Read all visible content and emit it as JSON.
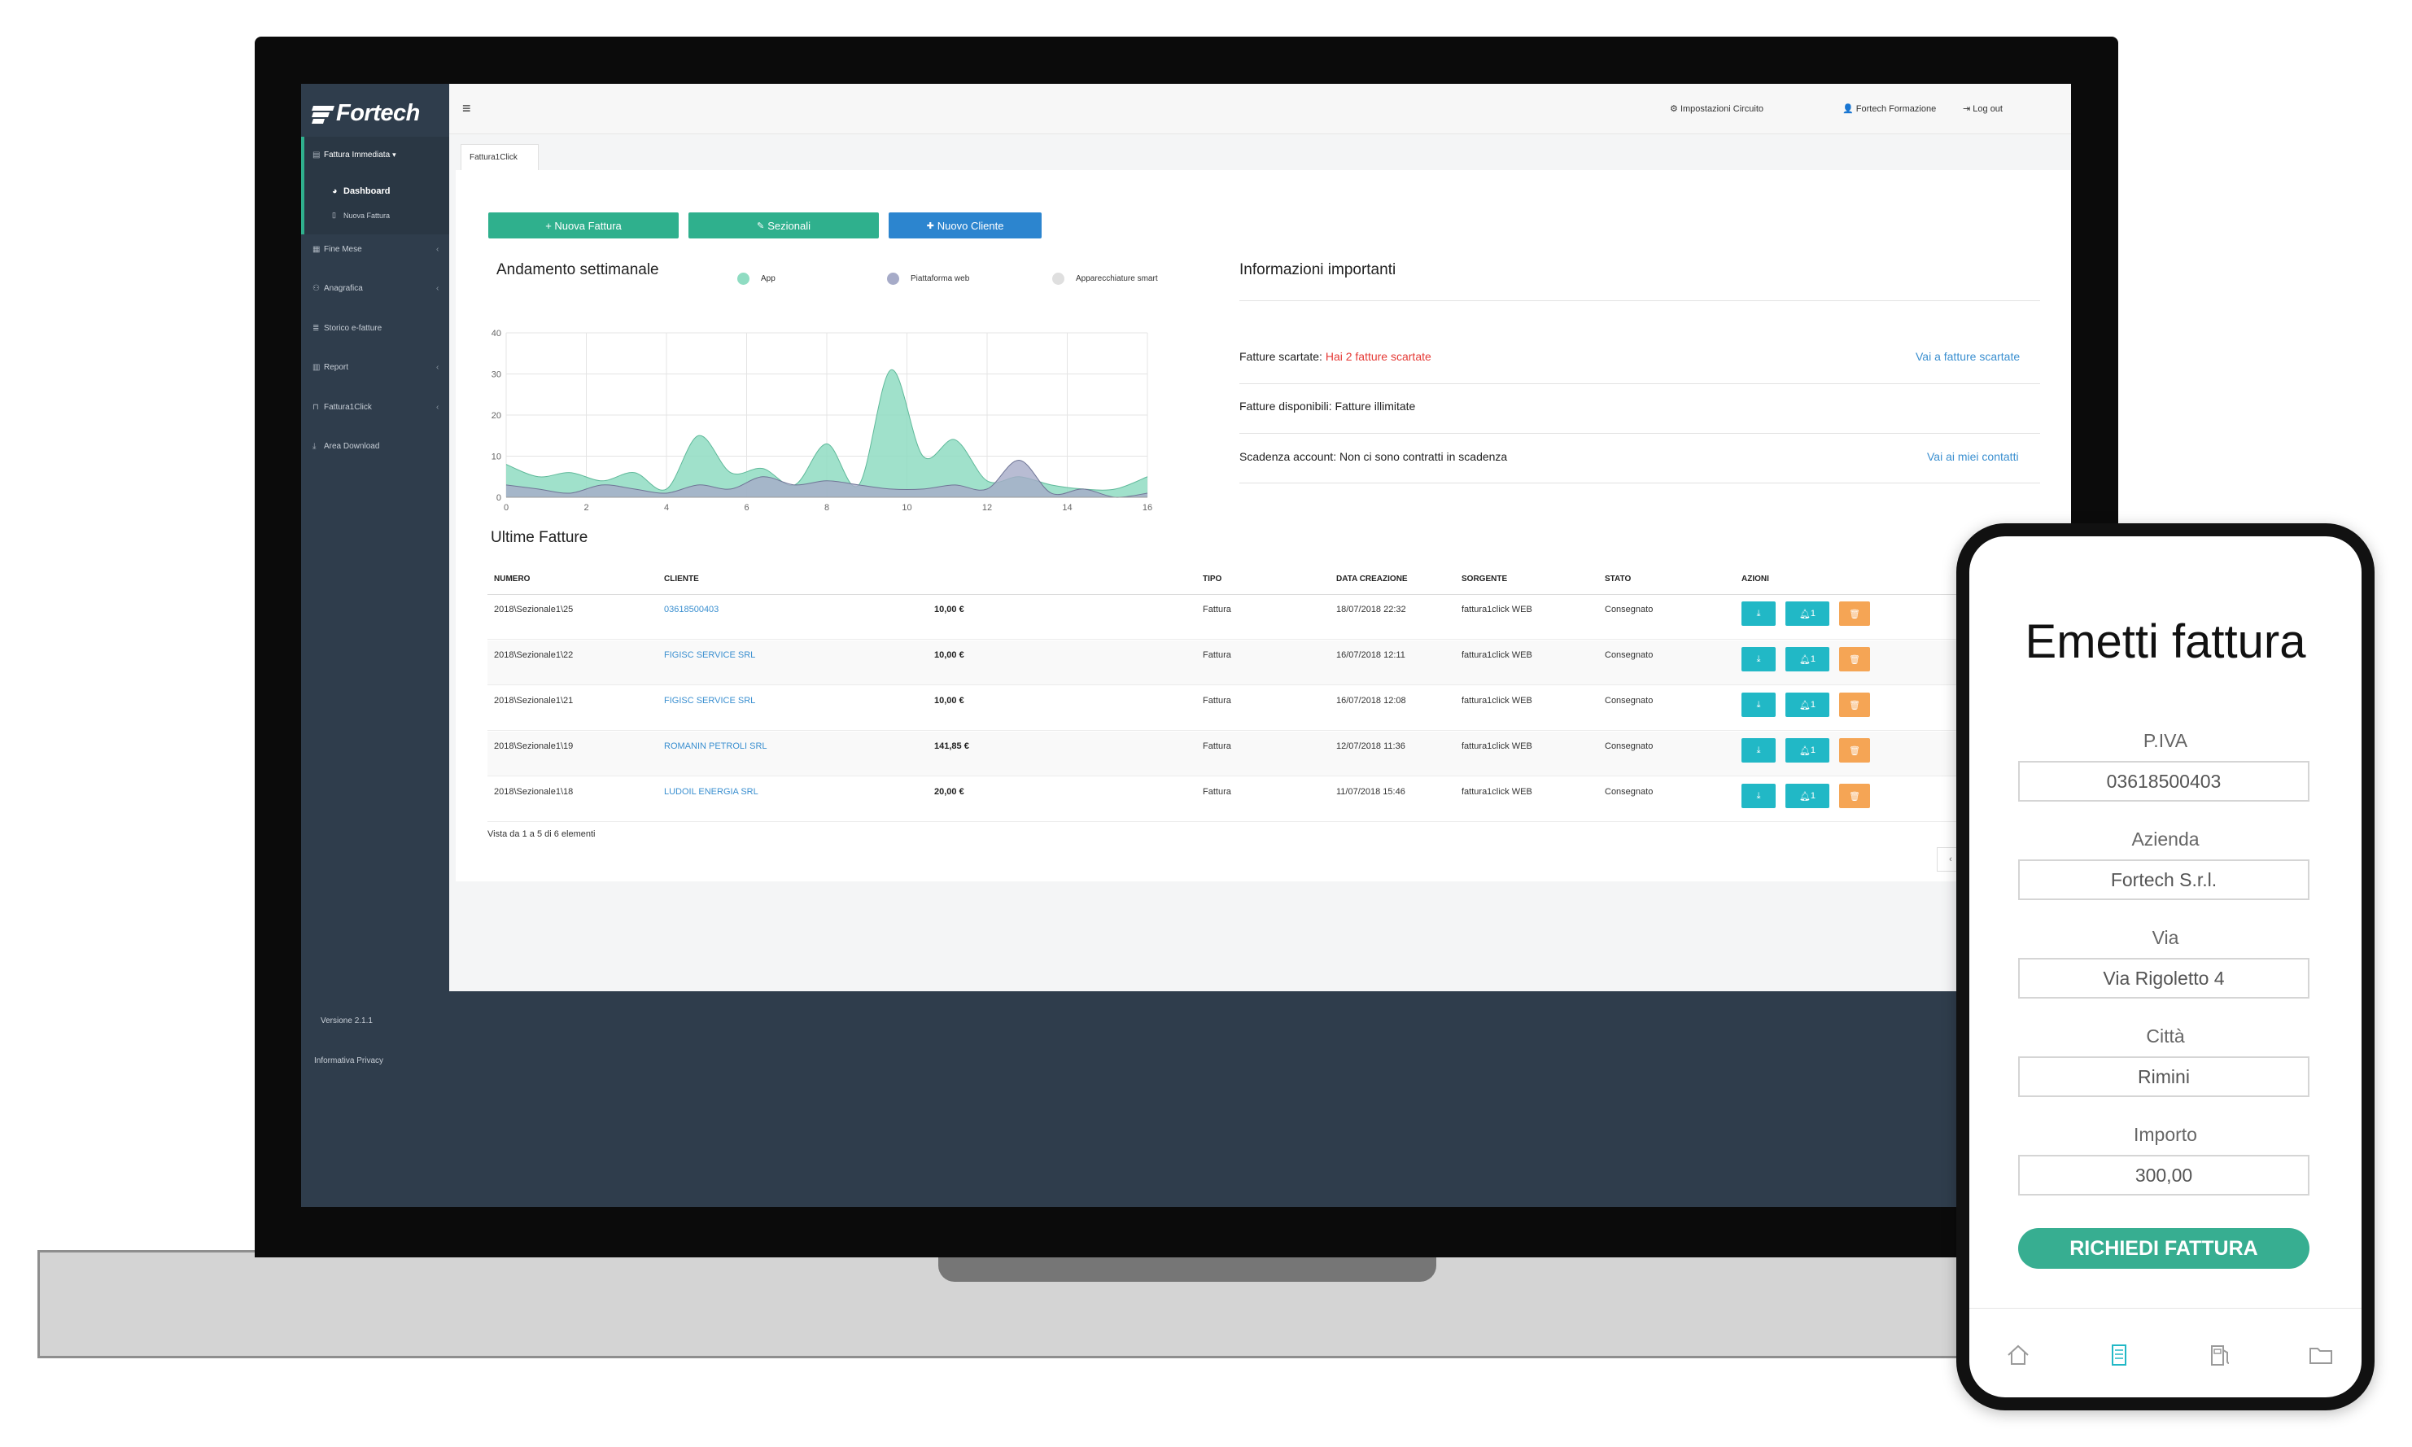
{
  "brand": {
    "name": "Fortech",
    "accent": "#2fb08d",
    "sidebar_bg": "#2f3d4c"
  },
  "sidebar": {
    "section": {
      "label": "Fattura Immediata",
      "icon": "invoice-icon"
    },
    "subitems": [
      {
        "label": "Dashboard",
        "icon": "dashboard-icon"
      },
      {
        "label": "Nuova Fattura",
        "icon": "document-icon"
      }
    ],
    "items": [
      {
        "label": "Fine Mese",
        "icon": "calendar-icon"
      },
      {
        "label": "Anagrafica",
        "icon": "users-icon"
      },
      {
        "label": "Storico e-fatture",
        "icon": "list-icon"
      },
      {
        "label": "Report",
        "icon": "bar-chart-icon"
      },
      {
        "label": "Fattura1Click",
        "icon": "lock-icon"
      },
      {
        "label": "Area Download",
        "icon": "download-icon"
      }
    ],
    "version": "Versione 2.1.1",
    "privacy": "Informativa Privacy"
  },
  "topbar": {
    "settings": "Impostazioni Circuito",
    "user": "Fortech Formazione",
    "logout": "Log out"
  },
  "tabs": [
    {
      "label": "Fattura1Click"
    }
  ],
  "actions": {
    "new_invoice": "+ Nuova Fattura",
    "sections": "Sezionali",
    "new_client": "Nuovo Cliente"
  },
  "chart_data": {
    "type": "area",
    "title": "Andamento settimanale",
    "x": [
      0,
      1,
      2,
      3,
      4,
      5,
      6,
      7,
      8,
      9,
      10,
      11,
      12,
      13,
      14,
      15,
      16
    ],
    "xticks": [
      0,
      2,
      4,
      6,
      8,
      10,
      12,
      14,
      16
    ],
    "yticks": [
      0,
      10,
      20,
      30,
      40
    ],
    "ylim": [
      0,
      40
    ],
    "xlim": [
      0,
      16
    ],
    "grid": true,
    "legend_position": "top",
    "series": [
      {
        "name": "App",
        "color": "#8fdcc2",
        "values": [
          8,
          5,
          6,
          4,
          6,
          2,
          15,
          6,
          7,
          3,
          13,
          3,
          31,
          10,
          14,
          4,
          5,
          3,
          2,
          2,
          5
        ]
      },
      {
        "name": "Piattaforma web",
        "color": "#a6abc8",
        "values": [
          3,
          2,
          1,
          3,
          2,
          1,
          3,
          2,
          5,
          3,
          4,
          3,
          2,
          2,
          3,
          2,
          9,
          1,
          2,
          0,
          1
        ]
      },
      {
        "name": "Apparecchiature smart",
        "color": "#dfdfdf",
        "values": []
      }
    ]
  },
  "info": {
    "title": "Informazioni importanti",
    "rows": [
      {
        "label": "Fatture scartate:",
        "value": "Hai 2 fatture scartate",
        "link": "Vai a fatture scartate"
      },
      {
        "label": "Fatture disponibili:",
        "value": "Fatture illimitate",
        "link": ""
      },
      {
        "label": "Scadenza account:",
        "value": "Non ci sono contratti in scadenza",
        "link": "Vai ai miei contatti"
      }
    ]
  },
  "table": {
    "title": "Ultime Fatture",
    "headers": [
      "NUMERO",
      "CLIENTE",
      "TIPO",
      "DATA CREAZIONE",
      "SORGENTE",
      "STATO",
      "AZIONI"
    ],
    "rows": [
      {
        "numero": "2018\\Sezionale1\\25",
        "cliente": "03618500403",
        "importo": "10,00 €",
        "tipo": "Fattura",
        "data": "18/07/2018 22:32",
        "sorgente": "fattura1click WEB",
        "stato": "Consegnato"
      },
      {
        "numero": "2018\\Sezionale1\\22",
        "cliente": "FIGISC SERVICE SRL",
        "importo": "10,00 €",
        "tipo": "Fattura",
        "data": "16/07/2018 12:11",
        "sorgente": "fattura1click WEB",
        "stato": "Consegnato"
      },
      {
        "numero": "2018\\Sezionale1\\21",
        "cliente": "FIGISC SERVICE SRL",
        "importo": "10,00 €",
        "tipo": "Fattura",
        "data": "16/07/2018 12:08",
        "sorgente": "fattura1click WEB",
        "stato": "Consegnato"
      },
      {
        "numero": "2018\\Sezionale1\\19",
        "cliente": "ROMANIN PETROLI SRL",
        "importo": "141,85 €",
        "tipo": "Fattura",
        "data": "12/07/2018 11:36",
        "sorgente": "fattura1click WEB",
        "stato": "Consegnato"
      },
      {
        "numero": "2018\\Sezionale1\\18",
        "cliente": "LUDOIL ENERGIA SRL",
        "importo": "20,00 €",
        "tipo": "Fattura",
        "data": "11/07/2018 15:46",
        "sorgente": "fattura1click WEB",
        "stato": "Consegnato"
      }
    ],
    "bell_count": "1",
    "footer": "Vista da 1 a 5 di 6 elementi",
    "pager_prev": "‹"
  },
  "phone": {
    "title": "Emetti fattura",
    "fields": [
      {
        "label": "P.IVA",
        "value": "03618500403"
      },
      {
        "label": "Azienda",
        "value": "Fortech S.r.l."
      },
      {
        "label": "Via",
        "value": "Via Rigoletto 4"
      },
      {
        "label": "Città",
        "value": "Rimini"
      },
      {
        "label": "Importo",
        "value": "300,00"
      }
    ],
    "button": "RICHIEDI FATTURA",
    "nav": [
      "home-icon",
      "document-icon",
      "fuel-pump-icon",
      "folder-icon"
    ],
    "nav_active": 1,
    "accent": "#37ae91"
  }
}
